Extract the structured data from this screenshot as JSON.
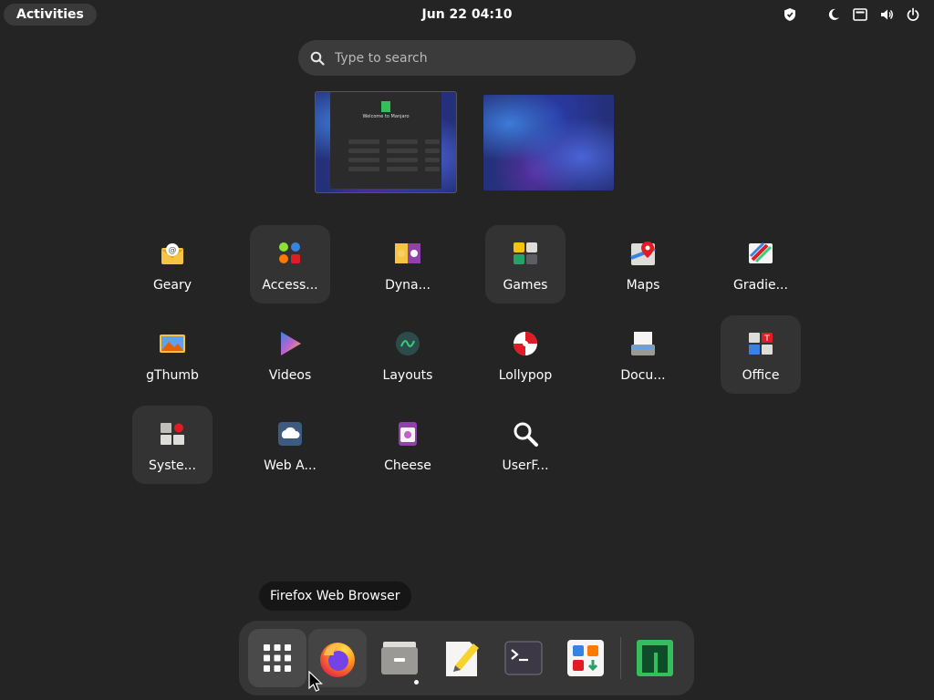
{
  "topbar": {
    "activities_label": "Activities",
    "clock": "Jun 22  04:10"
  },
  "search": {
    "placeholder": "Type to search"
  },
  "workspace": {
    "window_title": "Welcome to Manjaro"
  },
  "apps": [
    {
      "label": "Geary",
      "icon": "geary-mail-icon",
      "folder": false
    },
    {
      "label": "Access...",
      "icon": "accessories-folder-icon",
      "folder": true
    },
    {
      "label": "Dyna...",
      "icon": "dynamic-wallpaper-icon",
      "folder": false
    },
    {
      "label": "Games",
      "icon": "games-folder-icon",
      "folder": true
    },
    {
      "label": "Maps",
      "icon": "maps-icon",
      "folder": false
    },
    {
      "label": "Gradie...",
      "icon": "gradience-icon",
      "folder": false
    },
    {
      "label": "gThumb",
      "icon": "gthumb-icon",
      "folder": false
    },
    {
      "label": "Videos",
      "icon": "videos-icon",
      "folder": false
    },
    {
      "label": "Layouts",
      "icon": "layouts-icon",
      "folder": false
    },
    {
      "label": "Lollypop",
      "icon": "lollypop-icon",
      "folder": false
    },
    {
      "label": "Docu...",
      "icon": "document-scanner-icon",
      "folder": false
    },
    {
      "label": "Office",
      "icon": "office-folder-icon",
      "folder": true
    },
    {
      "label": "Syste...",
      "icon": "system-folder-icon",
      "folder": true
    },
    {
      "label": "Web A...",
      "icon": "web-apps-icon",
      "folder": false
    },
    {
      "label": "Cheese",
      "icon": "cheese-icon",
      "folder": false
    },
    {
      "label": "UserF...",
      "icon": "user-folders-search-icon",
      "folder": false
    }
  ],
  "tooltip": "Firefox Web Browser",
  "dock": [
    {
      "name": "show-apps",
      "icon": "app-grid-icon"
    },
    {
      "name": "firefox",
      "icon": "firefox-icon"
    },
    {
      "name": "files",
      "icon": "file-cabinet-icon"
    },
    {
      "name": "text-editor",
      "icon": "text-editor-icon"
    },
    {
      "name": "terminal",
      "icon": "terminal-icon"
    },
    {
      "name": "software",
      "icon": "software-store-icon"
    },
    {
      "name": "manjaro-hello",
      "icon": "manjaro-logo-icon"
    }
  ],
  "colors": {
    "background": "#242424",
    "manjaro_green": "#35bf5c",
    "folder_bg": "#333333"
  }
}
